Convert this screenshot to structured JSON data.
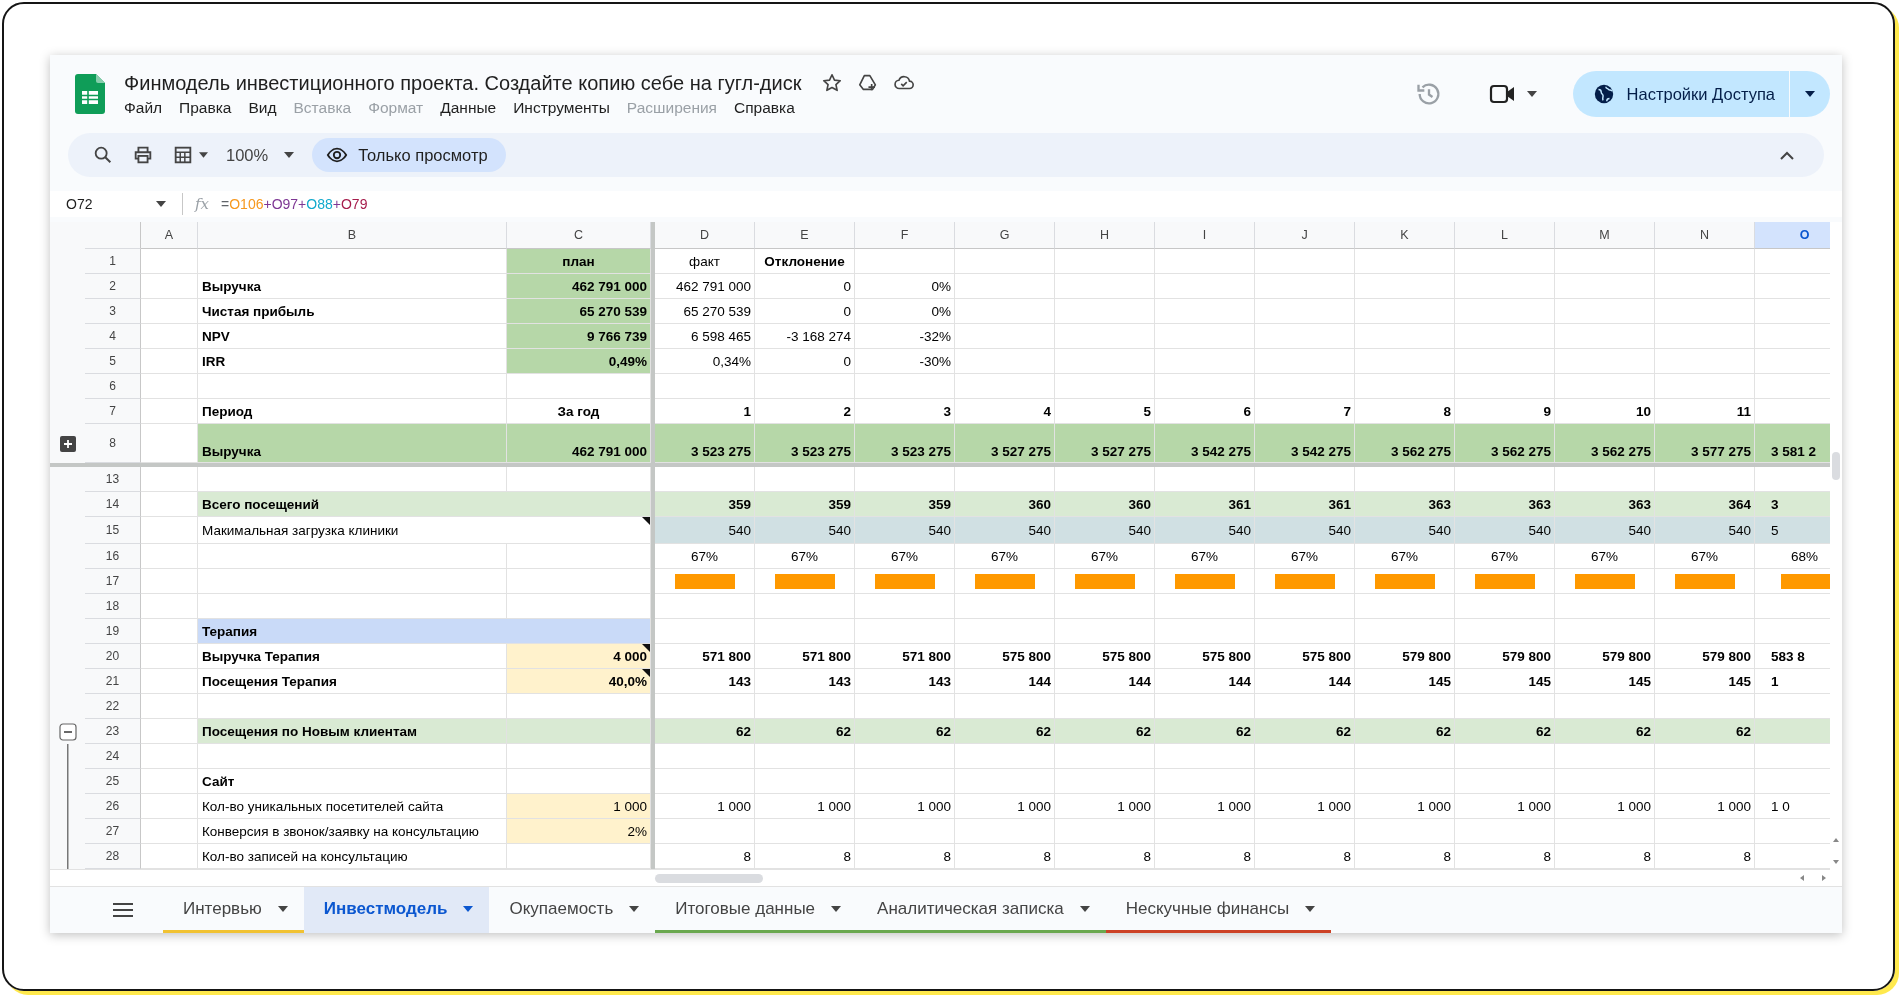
{
  "app": {
    "title": "Финмодель инвестиционного проекта. Создайте копию себе на гугл-диск",
    "menu": [
      {
        "label": "Файл",
        "disabled": false
      },
      {
        "label": "Правка",
        "disabled": false
      },
      {
        "label": "Вид",
        "disabled": false
      },
      {
        "label": "Вставка",
        "disabled": true
      },
      {
        "label": "Формат",
        "disabled": true
      },
      {
        "label": "Данные",
        "disabled": false
      },
      {
        "label": "Инструменты",
        "disabled": false
      },
      {
        "label": "Расширения",
        "disabled": true
      },
      {
        "label": "Справка",
        "disabled": false
      }
    ],
    "share_button": "Настройки Доступа"
  },
  "toolbar": {
    "zoom": "100%",
    "mode_chip": "Только просмотр"
  },
  "formula_bar": {
    "cell": "O72",
    "label": "fx",
    "parts": [
      {
        "text": "=",
        "color": "#5f6368"
      },
      {
        "text": "O106",
        "color": "#f7981d"
      },
      {
        "text": "+",
        "color": "#7e3794"
      },
      {
        "text": "O97",
        "color": "#7e3794"
      },
      {
        "text": "+",
        "color": "#7e3794"
      },
      {
        "text": "O88",
        "color": "#11a9cc"
      },
      {
        "text": "+",
        "color": "#7e3794"
      },
      {
        "text": "O79",
        "color": "#a61d4c"
      }
    ]
  },
  "sheet": {
    "columns": [
      {
        "letter": "A",
        "selected": false
      },
      {
        "letter": "B",
        "selected": false
      },
      {
        "letter": "C",
        "selected": false,
        "frozen_boundary": true
      },
      {
        "letter": "D",
        "selected": false
      },
      {
        "letter": "E",
        "selected": false
      },
      {
        "letter": "F",
        "selected": false
      },
      {
        "letter": "G",
        "selected": false
      },
      {
        "letter": "H",
        "selected": false
      },
      {
        "letter": "I",
        "selected": false
      },
      {
        "letter": "J",
        "selected": false
      },
      {
        "letter": "K",
        "selected": false
      },
      {
        "letter": "L",
        "selected": false
      },
      {
        "letter": "M",
        "selected": false
      },
      {
        "letter": "N",
        "selected": false
      },
      {
        "letter": "O",
        "selected": true
      }
    ],
    "rows": [
      {
        "number": "1",
        "kind": "plain",
        "bold": true,
        "cells": [
          {},
          {},
          {
            "text": "план",
            "kind": "plan",
            "heading": true
          },
          {
            "text": "факт",
            "bold": false,
            "heading": true
          },
          {
            "text": "Отклонение",
            "heading": true
          }
        ]
      },
      {
        "number": "2",
        "kind": "plain",
        "bold": false,
        "cells": [
          {},
          {
            "text": "Выручка",
            "bold": true
          },
          {
            "text": "462 791 000",
            "kind": "plan",
            "bold": true
          },
          {
            "text": "462 791 000"
          },
          {
            "text": "0"
          },
          {
            "text": "0%"
          }
        ]
      },
      {
        "number": "3",
        "kind": "plain",
        "bold": false,
        "cells": [
          {},
          {
            "text": "Чистая прибыль",
            "bold": true
          },
          {
            "text": "65 270 539",
            "kind": "plan",
            "bold": true
          },
          {
            "text": "65 270 539"
          },
          {
            "text": "0"
          },
          {
            "text": "0%"
          }
        ]
      },
      {
        "number": "4",
        "kind": "plain",
        "bold": false,
        "cells": [
          {},
          {
            "text": "NPV",
            "bold": true
          },
          {
            "text": "9 766 739",
            "kind": "plan",
            "bold": true
          },
          {
            "text": "6 598 465"
          },
          {
            "text": "-3 168 274"
          },
          {
            "text": "-32%"
          }
        ]
      },
      {
        "number": "5",
        "kind": "plain",
        "bold": false,
        "cells": [
          {},
          {
            "text": "IRR",
            "bold": true
          },
          {
            "text": "0,49%",
            "kind": "plan",
            "bold": true
          },
          {
            "text": "0,34%"
          },
          {
            "text": "0"
          },
          {
            "text": "-30%"
          }
        ]
      },
      {
        "number": "6",
        "kind": "plain"
      },
      {
        "number": "7",
        "kind": "plain",
        "bold": true,
        "cells": [
          {},
          {
            "text": "Период"
          },
          {
            "text": "За год",
            "heading": true
          },
          {
            "text": "1"
          },
          {
            "text": "2"
          },
          {
            "text": "3"
          },
          {
            "text": "4"
          },
          {
            "text": "5"
          },
          {
            "text": "6"
          },
          {
            "text": "7"
          },
          {
            "text": "8"
          },
          {
            "text": "9"
          },
          {
            "text": "10"
          },
          {
            "text": "11"
          }
        ]
      },
      {
        "number": "8",
        "kind": "total",
        "bold": true,
        "group": {
          "expanded": false
        },
        "frozen_boundary": true,
        "cells": [
          {},
          {
            "text": "Выручка"
          },
          {
            "text": "462 791 000"
          },
          {
            "text": "3 523 275"
          },
          {
            "text": "3 523 275"
          },
          {
            "text": "3 523 275"
          },
          {
            "text": "3 527 275"
          },
          {
            "text": "3 527 275"
          },
          {
            "text": "3 542 275"
          },
          {
            "text": "3 542 275"
          },
          {
            "text": "3 562 275"
          },
          {
            "text": "3 562 275"
          },
          {
            "text": "3 562 275"
          },
          {
            "text": "3 577 275"
          },
          {
            "text": "3 581 2"
          }
        ]
      },
      {
        "number": "13",
        "kind": "plain"
      },
      {
        "number": "14",
        "kind": "group",
        "bold": true,
        "cells": [
          {},
          {
            "text": "Всего посещений",
            "merged": true
          },
          {},
          {
            "text": "359"
          },
          {
            "text": "359"
          },
          {
            "text": "359"
          },
          {
            "text": "360"
          },
          {
            "text": "360"
          },
          {
            "text": "361"
          },
          {
            "text": "361"
          },
          {
            "text": "363"
          },
          {
            "text": "363"
          },
          {
            "text": "363"
          },
          {
            "text": "364"
          },
          {
            "text": "3"
          }
        ]
      },
      {
        "number": "15",
        "kind": "capacity",
        "bold": false,
        "cells": [
          {},
          {
            "text": "Макимальная загрузка клиники",
            "merged": true,
            "note": true
          },
          {},
          {
            "text": "540"
          },
          {
            "text": "540"
          },
          {
            "text": "540"
          },
          {
            "text": "540"
          },
          {
            "text": "540"
          },
          {
            "text": "540"
          },
          {
            "text": "540"
          },
          {
            "text": "540"
          },
          {
            "text": "540"
          },
          {
            "text": "540"
          },
          {
            "text": "540"
          },
          {
            "text": "5"
          }
        ]
      },
      {
        "number": "16",
        "kind": "ratio",
        "bold": false,
        "cells": [
          {},
          {},
          {},
          {
            "text": "67%"
          },
          {
            "text": "67%"
          },
          {
            "text": "67%"
          },
          {
            "text": "67%"
          },
          {
            "text": "67%"
          },
          {
            "text": "67%"
          },
          {
            "text": "67%"
          },
          {
            "text": "67%"
          },
          {
            "text": "67%"
          },
          {
            "text": "67%"
          },
          {
            "text": "67%"
          },
          {
            "text": "68%"
          }
        ]
      },
      {
        "number": "17",
        "kind": "plain",
        "cells": [
          {},
          {},
          {},
          {
            "kind": "bar"
          },
          {
            "kind": "bar"
          },
          {
            "kind": "bar"
          },
          {
            "kind": "bar"
          },
          {
            "kind": "bar"
          },
          {
            "kind": "bar"
          },
          {
            "kind": "bar"
          },
          {
            "kind": "bar"
          },
          {
            "kind": "bar"
          },
          {
            "kind": "bar"
          },
          {
            "kind": "bar"
          },
          {
            "kind": "bar"
          }
        ]
      },
      {
        "number": "18",
        "kind": "plain"
      },
      {
        "number": "19",
        "kind": "section",
        "bold": true,
        "cells": [
          {},
          {
            "text": "Терапия",
            "merged": true
          }
        ]
      },
      {
        "number": "20",
        "kind": "plain",
        "bold": true,
        "cells": [
          {},
          {
            "text": "Выручка Терапия"
          },
          {
            "text": "4 000",
            "kind": "input",
            "note": true
          },
          {
            "text": "571 800"
          },
          {
            "text": "571 800"
          },
          {
            "text": "571 800"
          },
          {
            "text": "575 800"
          },
          {
            "text": "575 800"
          },
          {
            "text": "575 800"
          },
          {
            "text": "575 800"
          },
          {
            "text": "579 800"
          },
          {
            "text": "579 800"
          },
          {
            "text": "579 800"
          },
          {
            "text": "579 800"
          },
          {
            "text": "583 8"
          }
        ]
      },
      {
        "number": "21",
        "kind": "plain",
        "bold": true,
        "cells": [
          {},
          {
            "text": "Посещения Терапия"
          },
          {
            "text": "40,0%",
            "kind": "input",
            "note": true
          },
          {
            "text": "143"
          },
          {
            "text": "143"
          },
          {
            "text": "143"
          },
          {
            "text": "144"
          },
          {
            "text": "144"
          },
          {
            "text": "144"
          },
          {
            "text": "144"
          },
          {
            "text": "145"
          },
          {
            "text": "145"
          },
          {
            "text": "145"
          },
          {
            "text": "145"
          },
          {
            "text": "1"
          }
        ]
      },
      {
        "number": "22",
        "kind": "plain"
      },
      {
        "number": "23",
        "kind": "group",
        "bold": true,
        "group": {
          "expanded": true
        },
        "cells": [
          {},
          {
            "text": "Посещения по Новым клиентам"
          },
          {},
          {
            "text": "62"
          },
          {
            "text": "62"
          },
          {
            "text": "62"
          },
          {
            "text": "62"
          },
          {
            "text": "62"
          },
          {
            "text": "62"
          },
          {
            "text": "62"
          },
          {
            "text": "62"
          },
          {
            "text": "62"
          },
          {
            "text": "62"
          },
          {
            "text": "62"
          }
        ]
      },
      {
        "number": "24",
        "kind": "plain"
      },
      {
        "number": "25",
        "kind": "plain",
        "bold": true,
        "cells": [
          {},
          {
            "text": "Сайт"
          }
        ]
      },
      {
        "number": "26",
        "kind": "plain",
        "bold": false,
        "cells": [
          {},
          {
            "text": "Кол-во уникальных посетителей сайта"
          },
          {
            "text": "1 000",
            "kind": "input"
          },
          {
            "text": "1 000"
          },
          {
            "text": "1 000"
          },
          {
            "text": "1 000"
          },
          {
            "text": "1 000"
          },
          {
            "text": "1 000"
          },
          {
            "text": "1 000"
          },
          {
            "text": "1 000"
          },
          {
            "text": "1 000"
          },
          {
            "text": "1 000"
          },
          {
            "text": "1 000"
          },
          {
            "text": "1 000"
          },
          {
            "text": "1 0"
          }
        ]
      },
      {
        "number": "27",
        "kind": "plain",
        "bold": false,
        "cells": [
          {},
          {
            "text": "Конверсия в звонок/заявку на консультацию"
          },
          {
            "text": "2%",
            "kind": "input"
          }
        ]
      },
      {
        "number": "28",
        "kind": "plain",
        "bold": false,
        "cells": [
          {},
          {
            "text": "Кол-во записей на консультацию"
          },
          {},
          {
            "text": "8"
          },
          {
            "text": "8"
          },
          {
            "text": "8"
          },
          {
            "text": "8"
          },
          {
            "text": "8"
          },
          {
            "text": "8"
          },
          {
            "text": "8"
          },
          {
            "text": "8"
          },
          {
            "text": "8"
          },
          {
            "text": "8"
          },
          {
            "text": "8"
          }
        ]
      }
    ]
  },
  "tabs": [
    {
      "label": "Интервью",
      "selected": false,
      "color": "#f1c232"
    },
    {
      "label": "Инвестмодель",
      "selected": true
    },
    {
      "label": "Окупаемость",
      "selected": false
    },
    {
      "label": "Итоговые данные",
      "selected": false,
      "color": "#6aa84f"
    },
    {
      "label": "Аналитическая записка",
      "selected": false,
      "color": "#6aa84f"
    },
    {
      "label": "Нескучные финансы",
      "selected": false,
      "color": "#cc4125"
    }
  ]
}
